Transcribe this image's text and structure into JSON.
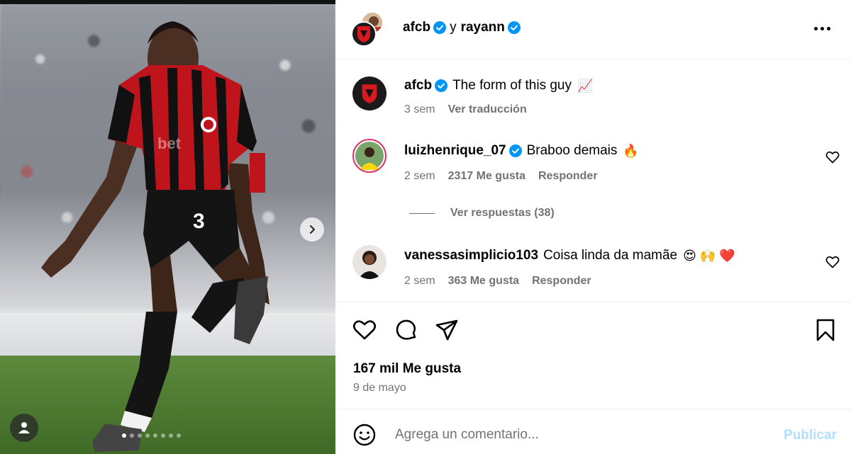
{
  "header": {
    "user1": "afcb",
    "joiner": "y",
    "user2": "rayann",
    "more_icon": "more-horizontal-icon"
  },
  "caption": {
    "username": "afcb",
    "text": "The form of this guy",
    "emoji": "📈",
    "time": "3 sem",
    "translate": "Ver traducción"
  },
  "comments": [
    {
      "username": "luizhenrique_07",
      "text": "Braboo demais",
      "emoji": "🔥",
      "time": "2 sem",
      "likes": "2317 Me gusta",
      "reply": "Responder"
    },
    {
      "username": "vanessasimplicio103",
      "text": "Coisa linda da mamãe",
      "emoji": "😍 🙌 ❤️",
      "time": "2 sem",
      "likes": "363 Me gusta",
      "reply": "Responder"
    }
  ],
  "view_replies": "Ver respuestas (38)",
  "post": {
    "likes": "167 mil Me gusta",
    "date": "9 de mayo",
    "carousel_total": 8,
    "carousel_active": 1
  },
  "composer": {
    "placeholder": "Agrega un comentario...",
    "submit": "Publicar"
  },
  "colors": {
    "verified": "#0095f6",
    "muted": "#737373",
    "publish_disabled": "#b2dffc",
    "afcb_red": "#d71920"
  }
}
